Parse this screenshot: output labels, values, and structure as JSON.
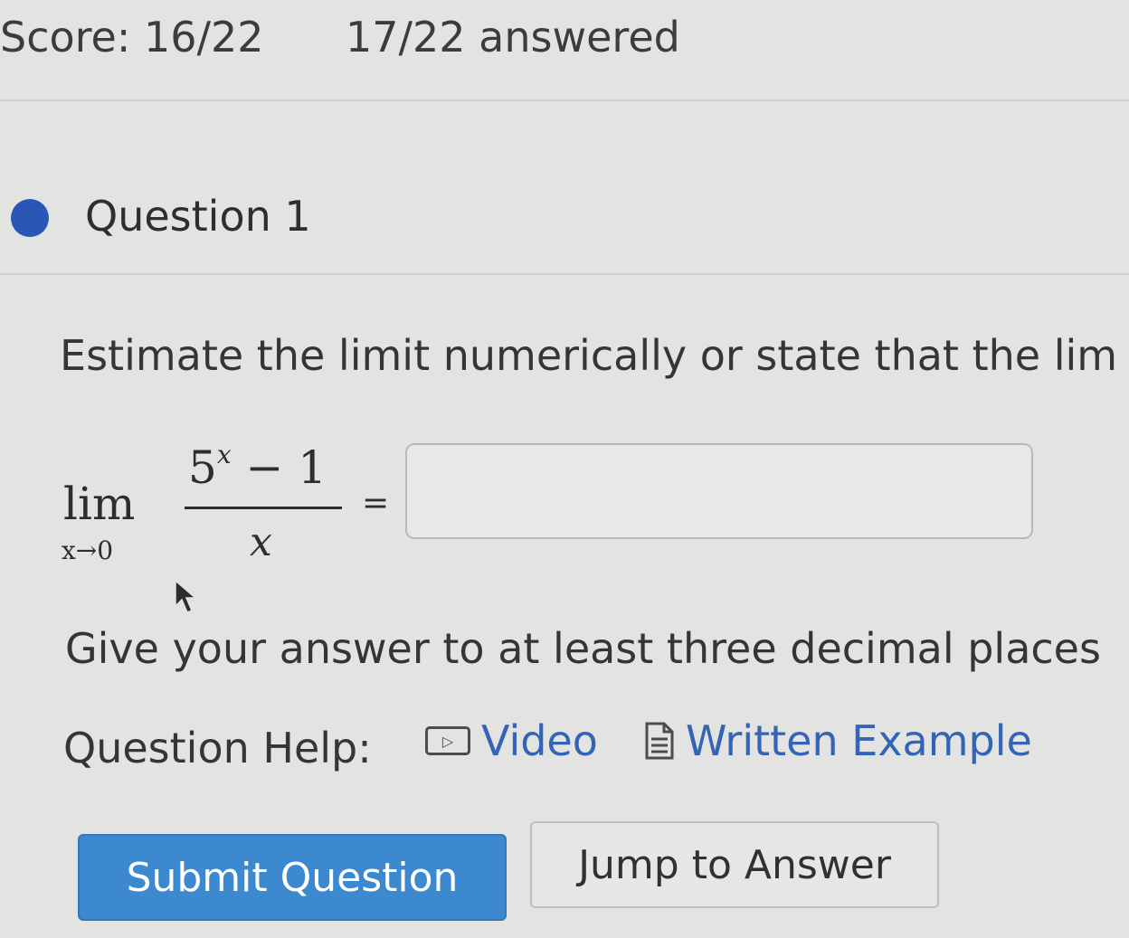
{
  "header": {
    "score": "Score: 16/22",
    "answered": "17/22 answered"
  },
  "question": {
    "title": "Question 1",
    "prompt": "Estimate the limit numerically or state that the lim",
    "math": {
      "lim": "lim",
      "lim_sub": "x→0",
      "numerator_base": "5",
      "numerator_exponent": "x",
      "numerator_rest": " − 1",
      "denominator": "x",
      "equals": "="
    },
    "answer": {
      "value": "",
      "placeholder": ""
    },
    "hint": "Give your answer to at least three decimal places"
  },
  "help": {
    "label": "Question Help:",
    "video": {
      "label": "Video",
      "icon": "video-play-icon"
    },
    "written": {
      "label": "Written Example",
      "icon": "document-icon"
    }
  },
  "buttons": {
    "submit": "Submit Question",
    "jump": "Jump to Answer"
  },
  "colors": {
    "background": "#e3e4e1",
    "question_dot": "#2a56b6",
    "link": "#3364b5",
    "submit_bg": "#3c89cf"
  }
}
